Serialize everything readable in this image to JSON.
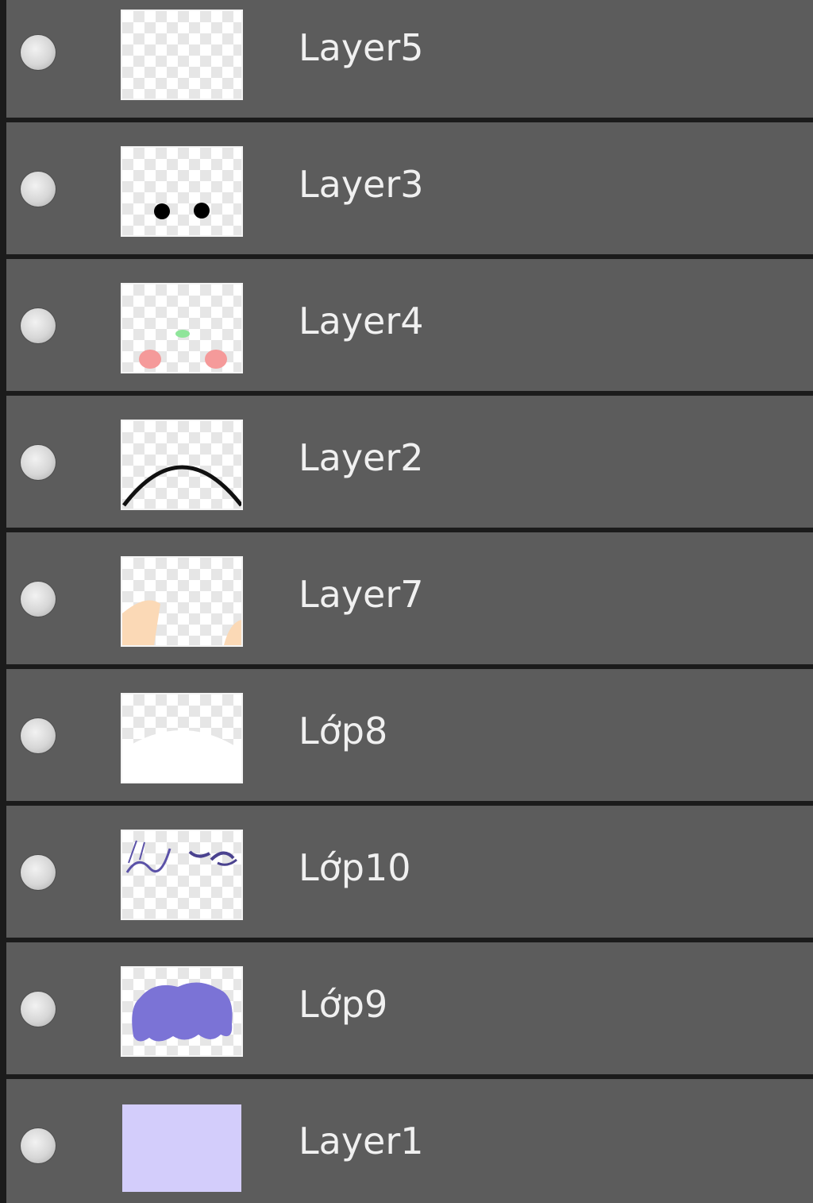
{
  "layers_panel": {
    "layers": [
      {
        "name": "Layer5",
        "thumbnail": "transparent",
        "visible": true
      },
      {
        "name": "Layer3",
        "thumbnail": "two-black-dots",
        "visible": true
      },
      {
        "name": "Layer4",
        "thumbnail": "pink-cheeks-green-mark",
        "visible": true
      },
      {
        "name": "Layer2",
        "thumbnail": "black-arc",
        "visible": true
      },
      {
        "name": "Layer7",
        "thumbnail": "skin-tone-corners",
        "visible": true
      },
      {
        "name": "Lớp8",
        "thumbnail": "white-lower-area",
        "visible": true
      },
      {
        "name": "Lớp10",
        "thumbnail": "purple-line-sketch",
        "visible": true
      },
      {
        "name": "Lớp9",
        "thumbnail": "purple-blob",
        "visible": true
      },
      {
        "name": "Layer1",
        "thumbnail": "lavender-fill",
        "visible": true
      }
    ]
  },
  "colors": {
    "panel_background": "#5c5c5c",
    "separator": "#1b1b1b",
    "text": "#f0f0f0",
    "lavender": "#d3cdfb",
    "purple": "#7b73d6",
    "cheek_pink": "#f59a9a",
    "mark_green": "#8fe59a",
    "skin": "#fbd9b6"
  }
}
